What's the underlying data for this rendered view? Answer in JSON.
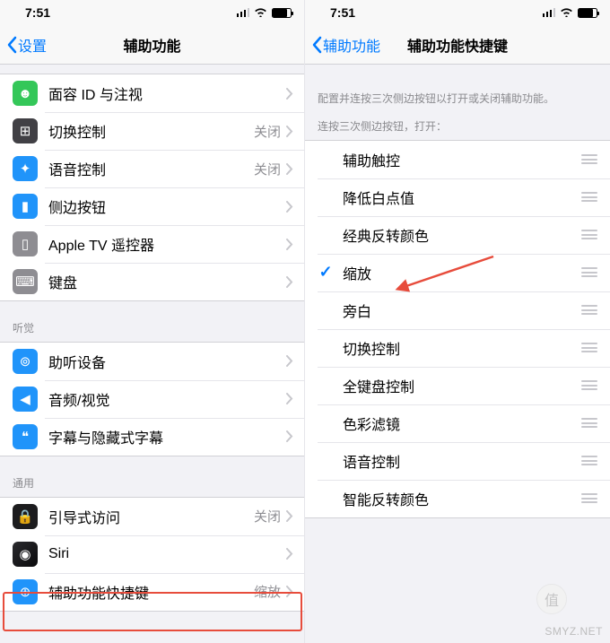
{
  "status": {
    "time": "7:51"
  },
  "left": {
    "back": "设置",
    "title": "辅助功能",
    "groups": [
      {
        "header": null,
        "rows": [
          {
            "icon": "face-id-icon",
            "bg": "bg-green",
            "label": "面容 ID 与注视",
            "value": "",
            "glyph": "☻"
          },
          {
            "icon": "switch-control-icon",
            "bg": "bg-darkgray",
            "label": "切换控制",
            "value": "关闭",
            "glyph": "⊞"
          },
          {
            "icon": "voice-control-icon",
            "bg": "bg-blue",
            "label": "语音控制",
            "value": "关闭",
            "glyph": "✦"
          },
          {
            "icon": "side-button-icon",
            "bg": "bg-blue",
            "label": "侧边按钮",
            "value": "",
            "glyph": "▮"
          },
          {
            "icon": "appletv-remote-icon",
            "bg": "bg-lightgray",
            "label": "Apple TV 遥控器",
            "value": "",
            "glyph": "▯"
          },
          {
            "icon": "keyboard-icon",
            "bg": "bg-lightgray",
            "label": "键盘",
            "value": "",
            "glyph": "⌨"
          }
        ]
      },
      {
        "header": "听觉",
        "rows": [
          {
            "icon": "hearing-icon",
            "bg": "bg-blue",
            "label": "助听设备",
            "value": "",
            "glyph": "⊚"
          },
          {
            "icon": "audio-visual-icon",
            "bg": "bg-blue",
            "label": "音频/视觉",
            "value": "",
            "glyph": "◀"
          },
          {
            "icon": "subtitles-icon",
            "bg": "bg-blue",
            "label": "字幕与隐藏式字幕",
            "value": "",
            "glyph": "❝"
          }
        ]
      },
      {
        "header": "通用",
        "rows": [
          {
            "icon": "guided-access-icon",
            "bg": "bg-black",
            "label": "引导式访问",
            "value": "关闭",
            "glyph": "🔒"
          },
          {
            "icon": "siri-icon",
            "bg": "bg-siri",
            "label": "Siri",
            "value": "",
            "glyph": "◉"
          },
          {
            "icon": "shortcut-icon",
            "bg": "bg-blue",
            "label": "辅助功能快捷键",
            "value": "缩放",
            "glyph": "⊕"
          }
        ]
      }
    ]
  },
  "right": {
    "back": "辅助功能",
    "title": "辅助功能快捷键",
    "intro": "配置并连按三次侧边按钮以打开或关闭辅助功能。",
    "subheader": "连按三次侧边按钮，打开：",
    "options": [
      {
        "label": "辅助触控",
        "checked": false
      },
      {
        "label": "降低白点值",
        "checked": false
      },
      {
        "label": "经典反转颜色",
        "checked": false
      },
      {
        "label": "缩放",
        "checked": true
      },
      {
        "label": "旁白",
        "checked": false
      },
      {
        "label": "切换控制",
        "checked": false
      },
      {
        "label": "全键盘控制",
        "checked": false
      },
      {
        "label": "色彩滤镜",
        "checked": false
      },
      {
        "label": "语音控制",
        "checked": false
      },
      {
        "label": "智能反转颜色",
        "checked": false
      }
    ]
  },
  "watermark": "SMYZ.NET",
  "watermark_badge": "值"
}
